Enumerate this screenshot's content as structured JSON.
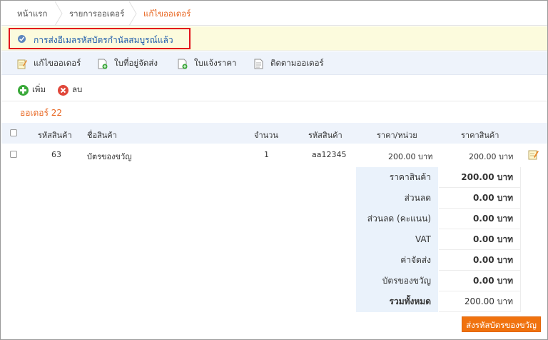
{
  "breadcrumb": {
    "home": "หน้าแรก",
    "orders": "รายการออเดอร์",
    "current": "แก้ไขออเดอร์"
  },
  "alert": {
    "message": "การส่งอีเมลรหัสบัตรกำนัลสมบูรณ์แล้ว",
    "icon": "check-circle-icon",
    "highlight_color": "#e3141b"
  },
  "toolbar": {
    "edit_order": "แก้ไขออเดอร์",
    "delivery_address": "ใบที่อยู่จัดส่ง",
    "quotation": "ใบแจ้งราคา",
    "track_order": "ติดตามออเดอร์"
  },
  "actions": {
    "add": "เพิ่ม",
    "delete": "ลบ"
  },
  "order_title": "ออเดอร์ 22",
  "table": {
    "headers": {
      "product_id": "รหัสสินค้า",
      "product_name": "ชื่อสินค้า",
      "quantity": "จำนวน",
      "sku": "รหัสสินค้า",
      "unit_price": "ราคา/หน่วย",
      "price": "ราคาสินค้า"
    },
    "rows": [
      {
        "product_id": "63",
        "product_name": "บัตรของขวัญ",
        "quantity": "1",
        "sku": "aa12345",
        "unit_price": "200.00 บาท",
        "price": "200.00 บาท"
      }
    ]
  },
  "summary": {
    "subtotal_label": "ราคาสินค้า",
    "subtotal_value": "200.00 บาท",
    "discount_label": "ส่วนลด",
    "discount_value": "0.00 บาท",
    "points_discount_label": "ส่วนลด (คะแนน)",
    "points_discount_value": "0.00 บาท",
    "vat_label": "VAT",
    "vat_value": "0.00 บาท",
    "shipping_label": "ค่าจัดส่ง",
    "shipping_value": "0.00 บาท",
    "gift_card_label": "บัตรของขวัญ",
    "gift_card_value": "0.00 บาท",
    "total_label": "รวมทั้งหมด",
    "total_value": "200.00 บาท"
  },
  "send_button": "ส่งรหัสบัตรของขวัญ",
  "colors": {
    "accent_orange": "#e8651f",
    "button_orange": "#f0720e",
    "link_blue": "#1c5aab",
    "alert_bg": "#fcfbdd",
    "toolbar_bg": "#eef3fb"
  }
}
